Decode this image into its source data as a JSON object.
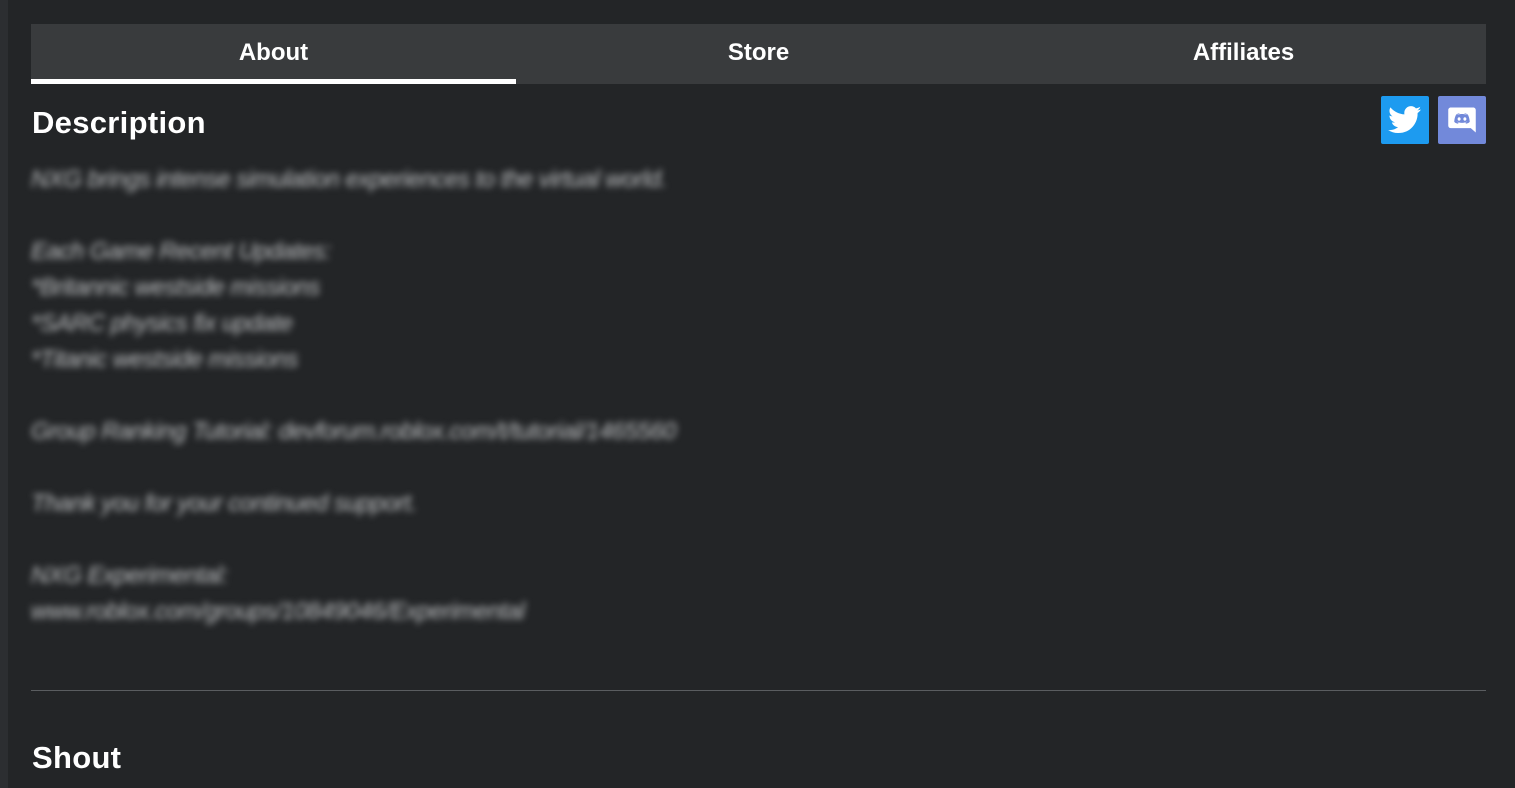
{
  "tabs": [
    {
      "label": "About",
      "active": true
    },
    {
      "label": "Store",
      "active": false
    },
    {
      "label": "Affiliates",
      "active": false
    }
  ],
  "description": {
    "title": "Description",
    "lines": [
      "NXG brings intense simulation experiences to the virtual world.",
      "",
      "Each Game Recent Updates:",
      "*Britannic westside missions",
      "*SARC physics fix update",
      "*Titanic westside missions",
      "",
      "Group Ranking Tutorial: devforum.roblox.com/t/tutorial/1465560",
      "",
      "Thank you for your continued support.",
      "",
      "NXG Experimental:",
      "www.roblox.com/groups/10849046/Experimental"
    ]
  },
  "social": {
    "twitter_icon": "twitter-icon",
    "discord_icon": "discord-icon",
    "twitter_color": "#1d9bf0",
    "discord_color": "#7289da"
  },
  "shout": {
    "title": "Shout"
  }
}
